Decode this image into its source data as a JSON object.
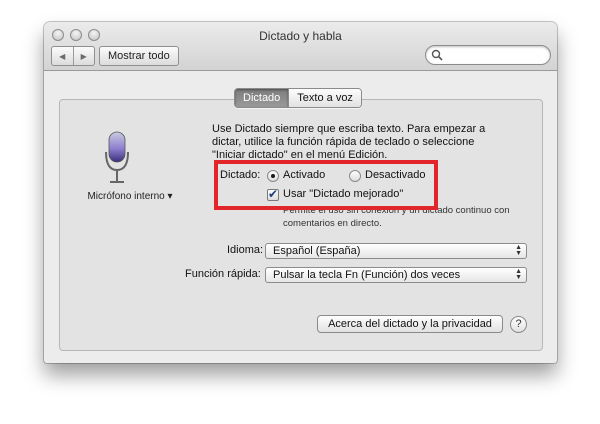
{
  "window": {
    "title": "Dictado y habla"
  },
  "toolbar": {
    "back_icon": "◀",
    "forward_icon": "▶",
    "show_all_label": "Mostrar todo",
    "search_placeholder": ""
  },
  "tabs": [
    {
      "label": "Dictado",
      "active": true
    },
    {
      "label": "Texto a voz",
      "active": false
    }
  ],
  "microphone": {
    "label": "Micrófono interno ▾"
  },
  "dictation": {
    "description": "Use Dictado siempre que escriba texto. Para empezar a dictar, utilice la función rápida de teclado o seleccione \"Iniciar dictado\" en el menú Edición.",
    "label": "Dictado:",
    "option_on": "Activado",
    "option_off": "Desactivado",
    "selected": "Activado",
    "enhanced_label": "Usar \"Dictado mejorado\"",
    "enhanced_checked": true,
    "enhanced_note_line1": "Permite el uso sin conexión y un dictado continuo con",
    "enhanced_note_line2": "comentarios en directo."
  },
  "language": {
    "label": "Idioma:",
    "value": "Español (España)"
  },
  "shortcut": {
    "label": "Función rápida:",
    "value": "Pulsar la tecla Fn (Función) dos veces"
  },
  "about_button": "Acerca del dictado y la privacidad",
  "help_button": "?",
  "colors": {
    "annotation_box": "#e2252b",
    "active_tab": "#8a8a8a"
  }
}
